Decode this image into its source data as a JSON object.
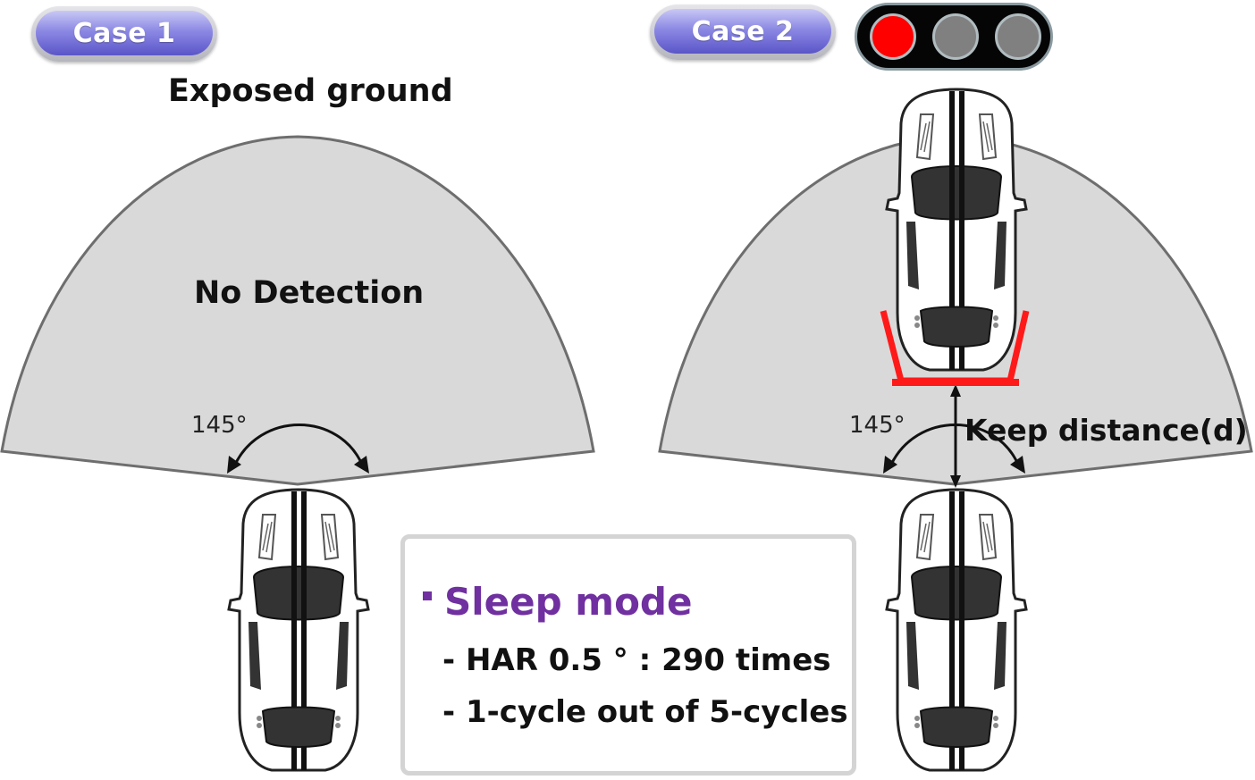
{
  "case1": {
    "badge": "Case 1",
    "heading": "Exposed ground",
    "fov_text": "No Detection",
    "angle_label": "145°"
  },
  "case2": {
    "badge": "Case 2",
    "angle_label": "145°",
    "distance_label": "Keep distance(d)"
  },
  "traffic_light": {
    "lamps": [
      {
        "state": "on",
        "color": "#ff0000"
      },
      {
        "state": "off",
        "color": "#808080"
      },
      {
        "state": "off",
        "color": "#808080"
      }
    ]
  },
  "sleep_mode": {
    "title": "Sleep mode",
    "lines": [
      "- HAR 0.5 °  : 290 times",
      "- 1-cycle out of 5-cycles"
    ]
  },
  "colors": {
    "fov_fill": "#d9d9d9",
    "fov_stroke": "#6e6e6e",
    "detection_bracket": "#ff0000",
    "accent_purple": "#7030a0",
    "badge_blue": "#6a66d6"
  }
}
